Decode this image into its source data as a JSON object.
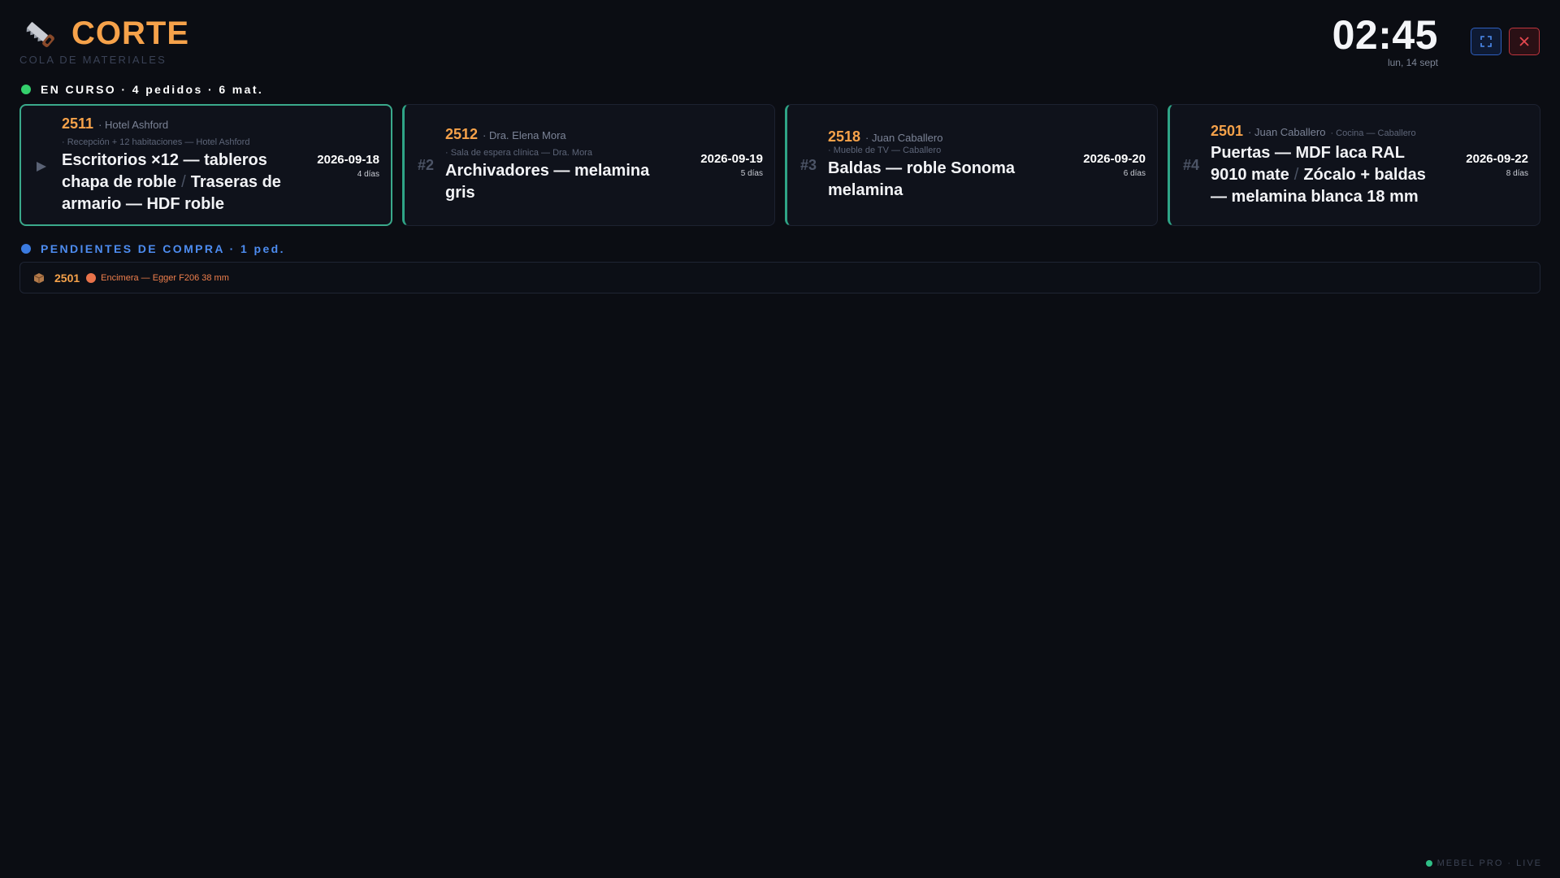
{
  "header": {
    "title": "CORTE",
    "subtitle": "COLA DE MATERIALES",
    "clock": "02:45",
    "date": "lun, 14 sept",
    "brand_icon": "saw-icon",
    "fullscreen_icon": "fullscreen-icon",
    "close_icon": "close-icon"
  },
  "colors": {
    "accent_orange": "#f6a24a",
    "active_green": "#34d06c",
    "pending_blue": "#4d8cf0",
    "card_border": "#2fa486",
    "close_red": "#c0353e"
  },
  "in_progress": {
    "label": "EN CURSO · 4 pedidos · 6 mat.",
    "cards": [
      {
        "marker": "▶",
        "id": "2511",
        "client": "· Hotel Ashford",
        "project": "· Recepción + 12 habitaciones — Hotel Ashford",
        "title_parts": [
          "Escritorios ×12 — tableros chapa de roble",
          "Traseras de armario — HDF roble"
        ],
        "date": "2026-09-18",
        "days": "4 días"
      },
      {
        "marker": "#2",
        "id": "2512",
        "client": "· Dra. Elena Mora",
        "project": "· Sala de espera clínica — Dra. Mora",
        "title_parts": [
          "Archivadores — melamina gris"
        ],
        "date": "2026-09-19",
        "days": "5 días"
      },
      {
        "marker": "#3",
        "id": "2518",
        "client": "· Juan Caballero",
        "project": "· Mueble de TV — Caballero",
        "title_parts": [
          "Baldas — roble Sonoma melamina"
        ],
        "date": "2026-09-20",
        "days": "6 días"
      },
      {
        "marker": "#4",
        "id": "2501",
        "client": "· Juan Caballero",
        "project": "· Cocina — Caballero",
        "title_parts": [
          "Puertas — MDF laca RAL 9010 mate",
          "Zócalo + baldas — melamina blanca 18 mm"
        ],
        "date": "2026-09-22",
        "days": "8 días"
      }
    ]
  },
  "pending": {
    "label": "PENDIENTES DE COMPRA · 1 ped.",
    "items": [
      {
        "icon": "box-icon",
        "id": "2501",
        "material": "Encimera — Egger F206 38 mm"
      }
    ]
  },
  "footer": {
    "label": "MEBEL PRO · LIVE"
  }
}
